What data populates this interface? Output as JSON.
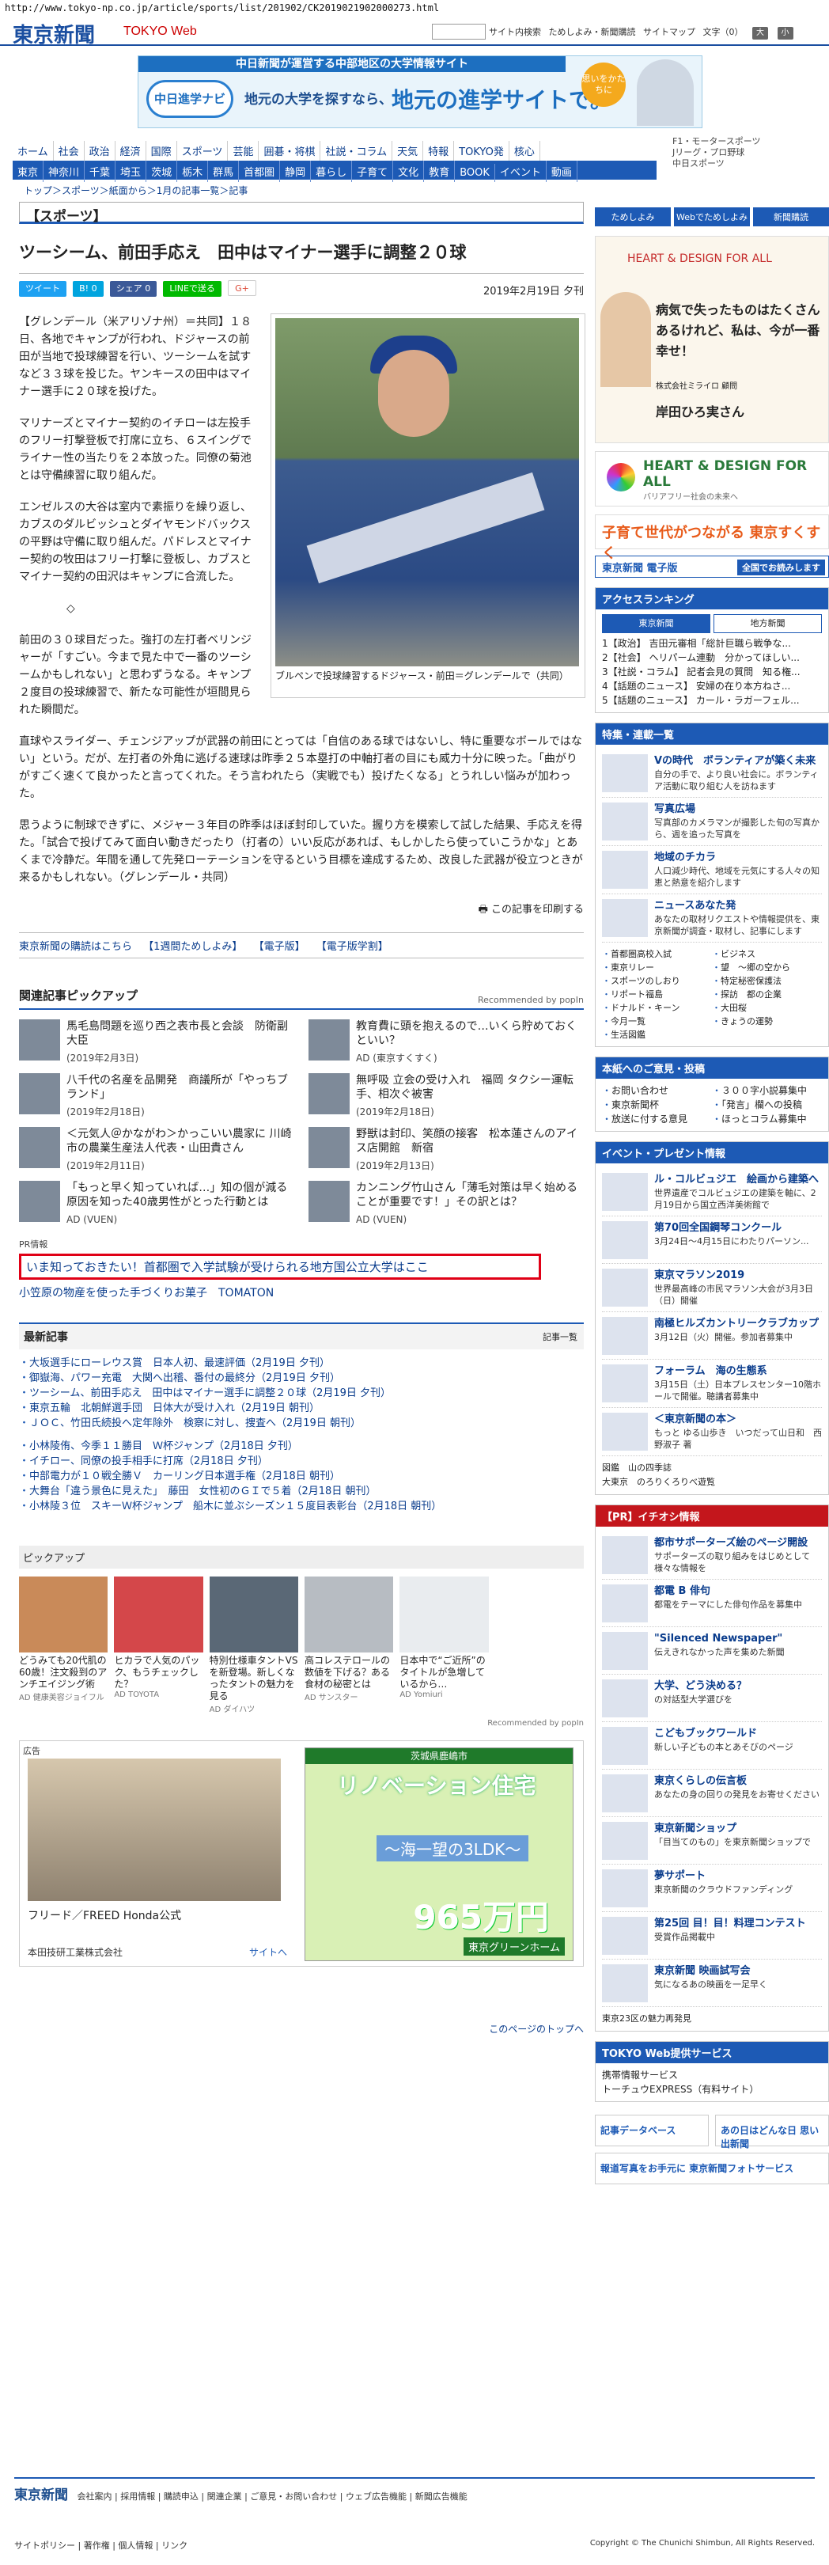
{
  "url": "http://www.tokyo-np.co.jp/article/sports/list/201902/CK2019021902000273.html",
  "header": {
    "logo": "東京新聞",
    "logo_sub": "TOKYO Web",
    "search_btn": "サイト内検索",
    "links": [
      "ためしよみ・新聞購読",
      "サイトマップ",
      "文字（0）"
    ],
    "font_btns": [
      "大",
      "小"
    ]
  },
  "banner": {
    "top": "中日新聞が運営する中部地区の大学情報サイト",
    "brand": "中日進学ナビ",
    "tagline": "地元の大学を探すなら、",
    "main": "地元の進学サイトで。",
    "badge": "思いをかたちに"
  },
  "nav1": [
    "ホーム",
    "社会",
    "政治",
    "経済",
    "国際",
    "スポーツ",
    "芸能",
    "囲碁・将棋",
    "社説・コラム",
    "天気",
    "特報",
    "TOKYO発",
    "核心"
  ],
  "nav2": [
    "東京",
    "神奈川",
    "千葉",
    "埼玉",
    "茨城",
    "栃木",
    "群馬",
    "首都圏",
    "静岡",
    "暮らし",
    "子育て",
    "文化",
    "教育",
    "BOOK",
    "イベント",
    "動画"
  ],
  "header_right": [
    "F1・モータースポーツ",
    "Jリーグ・プロ野球",
    "中日スポーツ"
  ],
  "breadcrumb": "トップ＞スポーツ＞紙面から＞1月の記事一覧＞記事",
  "article": {
    "category": "【スポーツ】",
    "title": "ツーシーム、前田手応え　田中はマイナー選手に調整２０球",
    "share": [
      "ツイート",
      "B! 0",
      "シェア 0",
      "LINEで送る",
      "G+"
    ],
    "date": "2019年2月19日 夕刊",
    "photo_caption": "ブルペンで投球練習するドジャース・前田＝グレンデールで（共同）",
    "paragraphs": [
      "【グレンデール（米アリゾナ州）＝共同】１８日、各地でキャンプが行われ、ドジャースの前田が当地で投球練習を行い、ツーシームを試すなど３３球を投じた。ヤンキースの田中はマイナー選手に２０球を投げた。",
      "マリナーズとマイナー契約のイチローは左投手のフリー打撃登板で打席に立ち、６スイングでライナー性の当たりを２本放った。同僚の菊池とは守備練習に取り組んだ。",
      "エンゼルスの大谷は室内で素振りを繰り返し、カブスのダルビッシュとダイヤモンドバックスの平野は守備に取り組んだ。パドレスとマイナー契約の牧田はフリー打撃に登板し、カブスとマイナー契約の田沢はキャンプに合流した。",
      "◇",
      "前田の３０球目だった。強打の左打者ベリンジャーが「すごい。今まで見た中で一番のツーシームかもしれない」と思わずうなる。キャンプ２度目の投球練習で、新たな可能性が垣間見られた瞬間だ。",
      "直球やスライダー、チェンジアップが武器の前田にとっては「自信のある球ではないし、特に重要なボールではない」という。だが、左打者の外角に逃げる速球は昨季２５本塁打の中軸打者の目にも威力十分に映った。「曲がりがすごく速くて良かったと言ってくれた。そう言われたら（実戦でも）投げたくなる」とうれしい悩みが加わった。",
      "思うように制球できずに、メジャー３年目の昨季はほぼ封印していた。握り方を模索して試した結果、手応えを得た。「試合で投げてみて面白い動きだったり（打者の）いい反応があれば、もしかしたら使っていこうかな」とあくまで冷静だ。年間を通して先発ローテーションを守るという目標を達成するため、改良した武器が役立つときが来るかもしれない。（グレンデール・共同）"
    ],
    "print": "この記事を印刷する"
  },
  "sublinks": [
    "東京新聞の購読はこちら",
    "【1週間ためしよみ】",
    "【電子版】",
    "【電子版学割】"
  ],
  "related": {
    "title": "関連記事ピックアップ",
    "powered": "Recommended by popIn",
    "items": [
      {
        "title": "馬毛島問題を巡り西之表市長と会談　防衛副大臣",
        "date": "(2019年2月3日)"
      },
      {
        "title": "教育費に頭を抱えるので…いくら貯めておくといい？",
        "date": "AD (東京すくすく)"
      },
      {
        "title": "八千代の名産を品開発　商議所が「やっちブランド」",
        "date": "(2019年2月18日)"
      },
      {
        "title": "無呼吸 立会の受け入れ　福岡 タクシー運転手、相次ぐ被害",
        "date": "(2019年2月18日)"
      },
      {
        "title": "＜元気人＠かながわ＞かっこいい農家に 川崎市の農業生産法人代表・山田貴さん",
        "date": "(2019年2月11日)"
      },
      {
        "title": "野獣は封印、笑顔の接客　松本蓮さんのアイス店開館　新宿",
        "date": "(2019年2月13日)"
      },
      {
        "title": "「もっと早く知っていれば…」知の個が減る原因を知った40歳男性がとった行動とは",
        "date": "AD (VUEN)"
      },
      {
        "title": "カンニング竹山さん「薄毛対策は早く始めることが重要です！」その訳とは？",
        "date": "AD (VUEN)"
      }
    ]
  },
  "pr": {
    "label": "PR情報",
    "highlight": "いま知っておきたい！首都圏で入学試験が受けられる地方国公立大学はここ",
    "tomato": "小笠原の物産を使った手づくりお菓子　TOMATON"
  },
  "latest": {
    "title": "最新記事",
    "more": "記事一覧",
    "items": [
      "大坂選手にローレウス賞　日本人初、最速評価（2月19日 夕刊）",
      "御嶽海、パワー充電　大関へ出稽、番付の最終分（2月19日 夕刊）",
      "ツーシーム、前田手応え　田中はマイナー選手に調整２０球（2月19日 夕刊）",
      "東京五輪　北朝鮮選手団　日体大が受け入れ（2月19日 朝刊）",
      "ＪＯＣ、竹田氏続投へ定年除外　検察に対し、捜査へ（2月19日 朝刊）",
      "小林陵侑、今季１１勝目　Ｗ杯ジャンプ（2月18日 夕刊）",
      "イチロー、同僚の投手相手に打席（2月18日 夕刊）",
      "中部電力が１０戦全勝Ｖ　カーリング日本選手権（2月18日 朝刊）",
      "大舞台「違う景色に見えた」　藤田　女性初のＧＩで５着（2月18日 朝刊）",
      "小林陵３位　スキーＷ杯ジャンプ　船木に並ぶシーズン１５度目表彰台（2月18日 朝刊）"
    ]
  },
  "pickup": {
    "title": "ピックアップ",
    "items": [
      {
        "title": "どうみても20代肌の60歳！注文殺到のアンチエイジング術",
        "src": "AD 健康美容ジョイフル"
      },
      {
        "title": "ヒカラで人気のパック、もうチェックした？",
        "src": "AD TOYOTA"
      },
      {
        "title": "特別仕様車タントVSを新登場。新しくなったタントの魅力を見る",
        "src": "AD ダイハツ"
      },
      {
        "title": "高コレステロールの数値を下げる？ある食材の秘密とは",
        "src": "AD サンスター"
      },
      {
        "title": "日本中で“ご近所”のタイトルが急増しているから…",
        "src": "AD Yomiuri"
      },
      {
        "title": "",
        "src": ""
      }
    ],
    "recommended": "Recommended by popIn"
  },
  "ad": {
    "label": "広告",
    "car": "フリード／FREED Honda公式",
    "maker": "本田技研工業株式会社",
    "site": "サイトへ",
    "reno_top": "茨城県鹿嶋市",
    "reno_title": "リノベーション住宅",
    "reno_sub": "〜海一望の3LDK〜",
    "reno_price": "965万円",
    "reno_co": "東京グリーンホーム"
  },
  "totop": "このページのトップへ",
  "sidebar": {
    "tabs": [
      "ためしよみ",
      "Webでためしよみ",
      "新聞購読"
    ],
    "heart_ad": {
      "brand": "HEART & DESIGN FOR ALL",
      "msg": "病気で失ったものはたくさんあるけれど、私は、今が一番幸せ！",
      "org": "株式会社ミライロ 顧問",
      "name": "岸田ひろ実さん"
    },
    "heart2": {
      "title": "HEART & DESIGN FOR ALL",
      "sub": "バリアフリー社会の未来へ"
    },
    "sukusuku": "子育て世代がつながる 東京すくすく",
    "denshi": {
      "label": "東京新聞 電子版",
      "btn": "全国でお読みします"
    },
    "ranking": {
      "title": "アクセスランキング",
      "tabs": [
        "東京新聞",
        "地方新聞"
      ],
      "items": [
        "1【政治】 吉田元審相「総計巨職ら戦争な...",
        "2【社会】 ヘリパーム連動　分かってほしい...",
        "3【社説・コラム】 記者会見の質問　知る権...",
        "4【話題のニュース】 安婦の在り本方ねさ...",
        "5【話題のニュース】 カール・ラガーフェル..."
      ]
    },
    "tokushu": {
      "title": "特集・連載一覧",
      "items": [
        {
          "t": "Vの時代　ボランティアが築く未来",
          "x": "自分の手で、より良い社会に。ボランティア活動に取り組む人を訪ねます"
        },
        {
          "t": "写真広場",
          "x": "写真部のカメラマンが撮影した旬の写真から、週を追った写真を"
        },
        {
          "t": "地域のチカラ",
          "x": "人口減少時代、地域を元気にする人々の知恵と熱意を紹介します"
        },
        {
          "t": "ニュースあなた発",
          "x": "あなたの取材リクエストや情報提供を、東京新聞が調査・取材し、記事にします"
        }
      ],
      "links": [
        "首都圏高校入試",
        "東京リレー",
        "スポーツのしおり",
        "リポート福島",
        "ドナルド・キーン",
        "今月一覧",
        "生活図鑑",
        "ビジネス",
        "望　〜郷の空から",
        "特定秘密保護法",
        "探訪　都の企業",
        "大田桜",
        "きょうの運勢"
      ]
    },
    "toko": {
      "title": "本紙へのご意見・投稿",
      "links": [
        "お問い合わせ",
        "東京新聞杯",
        "放送に付する意見",
        "３００字小説募集中",
        "「発言」欄への投稿",
        "ほっとコラム募集中"
      ]
    },
    "event": {
      "title": "イベント・プレゼント情報",
      "items": [
        {
          "t": "ル・コルビュジエ　絵画から建築へ",
          "x": "世界遺産でコルビュジエの建築を軸に、2月19日から国立西洋美術館で"
        },
        {
          "t": "第70回全国鋼琴コンクール",
          "x": "3月24日〜4月15日にわたりパーソン..."
        },
        {
          "t": "東京マラソン2019",
          "x": "世界最高峰の市民マラソン大会が3月3日（日）開催"
        },
        {
          "t": "南極ヒルズカントリークラブカップ",
          "x": "3月12日（火）開催。参加者募集中"
        },
        {
          "t": "フォーラム　海の生態系",
          "x": "3月15日（土）日本プレスセンター10階ホールで開催。聴講者募集中"
        },
        {
          "t": "＜東京新聞の本＞",
          "x": "もっと ゆる山歩き　いつだって山日和　西野淑子 著"
        }
      ],
      "links": [
        "図鑑　山の四季誌",
        "大東京　のろりくろりべ遊覧"
      ]
    },
    "pr": {
      "title": "【PR】イチオシ情報",
      "items": [
        {
          "t": "都市サポーターズ絵のページ開設",
          "x": "サポーターズの取り組みをはじめとして様々な情報を"
        },
        {
          "t": "都電 B 俳句",
          "x": "都電をテーマにした俳句作品を募集中"
        },
        {
          "t": "\"Silenced Newspaper\"",
          "x": "伝えきれなかった声を集めた新聞"
        },
        {
          "t": "大学、どう決める？",
          "x": "の対話型大学選びを"
        },
        {
          "t": "こどもブックワールド",
          "x": "新しい子どもの本とあそびのページ"
        },
        {
          "t": "東京くらしの伝言板",
          "x": "あなたの身の回りの発見をお寄せください"
        },
        {
          "t": "東京新聞ショップ",
          "x": "「目当てのもの」を東京新聞ショップで"
        },
        {
          "t": "夢サポート",
          "x": "東京新聞のクラウドファンディング"
        },
        {
          "t": "第25回 目！目！料理コンテスト",
          "x": "受賞作品掲載中"
        },
        {
          "t": "東京新聞 映画試写会",
          "x": "気になるあの映画を一足早く"
        }
      ],
      "links": [
        "東京23区の魅力再発見"
      ]
    },
    "tokyoweb": {
      "title": "TOKYO Web提供サービス",
      "links": [
        "携帯情報サービス",
        "トーチュウEXPRESS（有料サイト）"
      ]
    },
    "bottom": [
      "記事データベース",
      "あの日はどんな日 思い出新聞",
      "報道写真をお手元に 東京新聞フォトサービス"
    ]
  },
  "footer": {
    "logo": "東京新聞",
    "links": [
      "会社案内",
      "採用情報",
      "購読申込",
      "関連企業",
      "ご意見・お問い合わせ",
      "ウェブ広告機能",
      "新聞広告機能"
    ],
    "links2": [
      "サイトポリシー",
      "著作権",
      "個人情報",
      "リンク"
    ],
    "copyright": "Copyright © The Chunichi Shimbun, All Rights Reserved."
  }
}
